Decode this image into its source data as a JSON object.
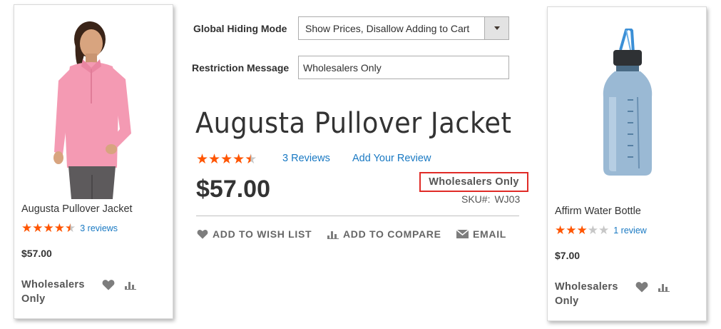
{
  "config": {
    "hiding_mode_label": "Global Hiding Mode",
    "hiding_mode_value": "Show Prices, Disallow Adding to Cart",
    "restriction_message_label": "Restriction Message",
    "restriction_message_value": "Wholesalers Only"
  },
  "product": {
    "title": "Augusta Pullover Jacket",
    "rating_stars": 4.5,
    "reviews_link": "3 Reviews",
    "add_review_link": "Add Your Review",
    "price": "$57.00",
    "restriction": "Wholesalers Only",
    "sku_label": "SKU#:",
    "sku_value": "WJ03",
    "actions": {
      "wishlist": "ADD TO WISH LIST",
      "compare": "ADD TO COMPARE",
      "email": "EMAIL"
    }
  },
  "cards": [
    {
      "name": "Augusta Pullover Jacket",
      "rating_stars": 4.5,
      "reviews": "3 reviews",
      "price": "$57.00",
      "restriction": "Wholesalers Only"
    },
    {
      "name": "Affirm Water Bottle",
      "rating_stars": 3,
      "reviews": "1 review",
      "price": "$7.00",
      "restriction": "Wholesalers Only"
    }
  ],
  "colors": {
    "star_on": "#ff5501",
    "star_off": "#c7c7c7",
    "link": "#1979c3",
    "highlight_border": "#e02b27"
  },
  "icons": [
    "heart-icon",
    "compare-icon",
    "envelope-icon",
    "dropdown-arrow-icon",
    "star-icon"
  ]
}
